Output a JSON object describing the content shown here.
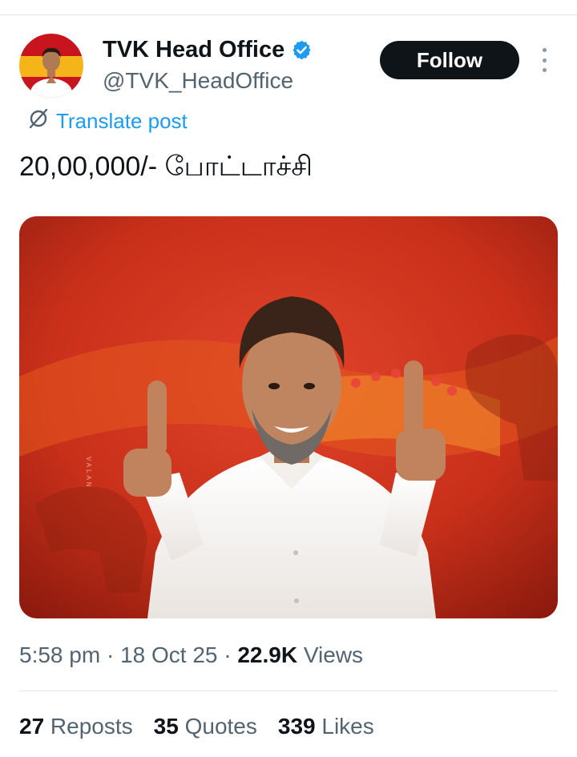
{
  "author": {
    "display_name": "TVK Head Office",
    "handle": "@TVK_HeadOffice"
  },
  "follow_label": "Follow",
  "translate_label": "Translate post",
  "post_text": "20,00,000/- போட்டாச்சி",
  "media": {
    "watermark": "VALAN"
  },
  "meta": {
    "time": "5:58 pm",
    "sep1": " · ",
    "date": "18 Oct 25",
    "sep2": " · ",
    "views_count": "22.9K",
    "views_label": " Views"
  },
  "stats": {
    "reposts_count": "27",
    "reposts_label": " Reposts",
    "quotes_count": "35",
    "quotes_label": " Quotes",
    "likes_count": "339",
    "likes_label": " Likes"
  },
  "colors": {
    "accent": "#1d9bf0",
    "follow_bg": "#0f1419",
    "secondary_text": "#536471",
    "media_red": "#c9301a"
  },
  "icons": {
    "verified": "verified-badge-icon",
    "translate": "translate-icon",
    "more": "more-dots-icon"
  }
}
